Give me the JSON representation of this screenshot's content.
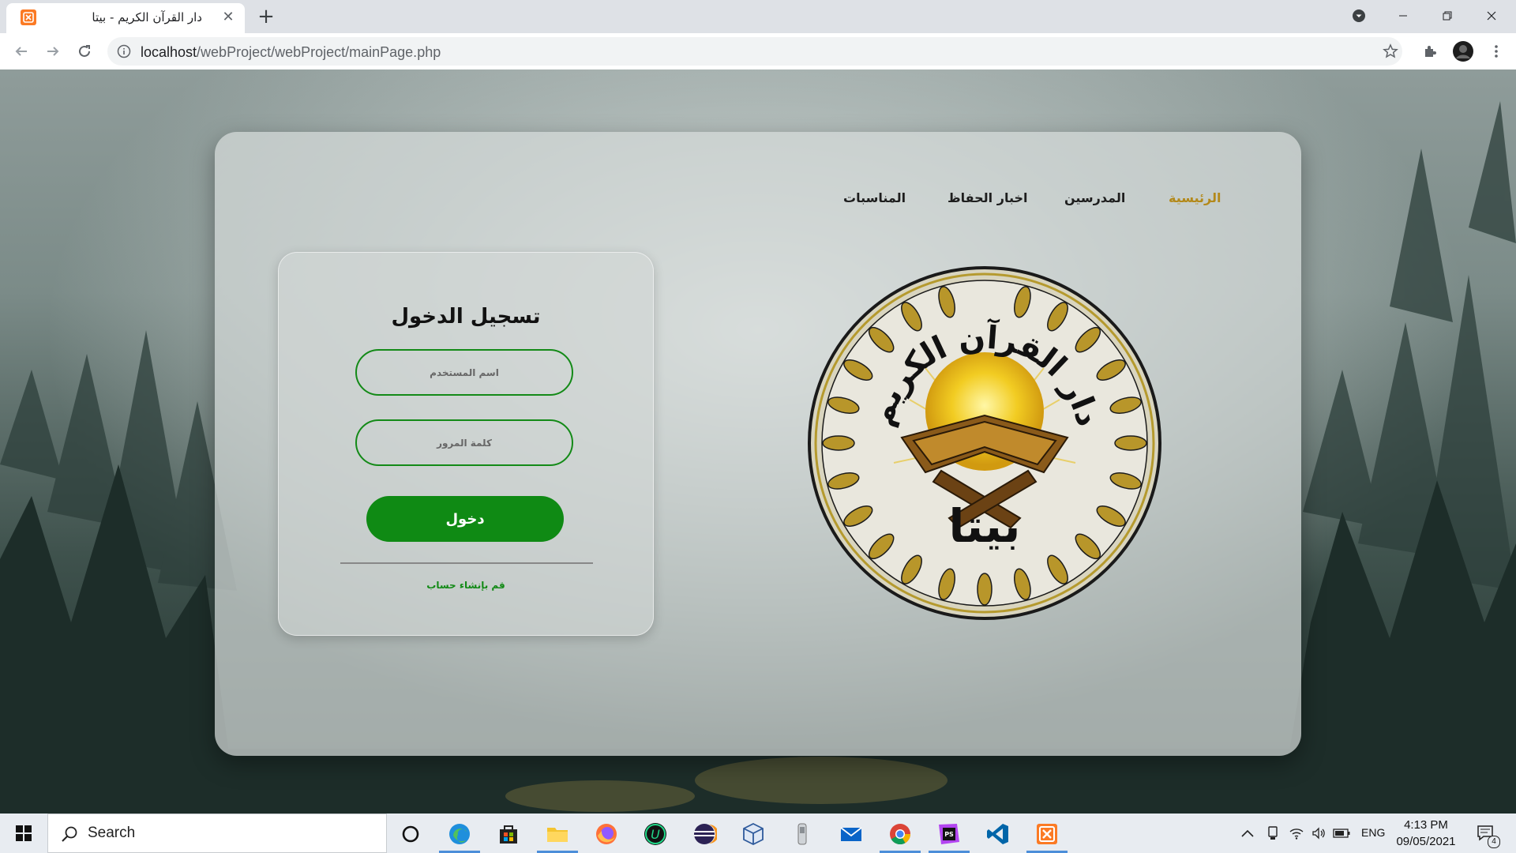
{
  "browser": {
    "tab_title": "دار القرآن الكريم - بيتا",
    "tab_close": "✕",
    "new_tab": "+",
    "url_host": "localhost",
    "url_path": "/webProject/webProject/mainPage.php"
  },
  "nav": {
    "items": [
      {
        "label": "الرئيسية",
        "active": true
      },
      {
        "label": "المدرسين",
        "active": false
      },
      {
        "label": "اخبار الحفاظ",
        "active": false
      },
      {
        "label": "المناسبات",
        "active": false
      }
    ]
  },
  "login": {
    "title": "تسجيل الدخول",
    "username_placeholder": "اسم المستخدم",
    "password_placeholder": "كلمة المرور",
    "submit_label": "دخول",
    "signup_link": "قم بإنشاء حساب"
  },
  "logo": {
    "arc_text": "دار القرآن الكريم",
    "name_text": "بيتا"
  },
  "taskbar": {
    "search_placeholder": "Search",
    "lang": "ENG",
    "time": "4:13 PM",
    "date": "09/05/2021",
    "notification_count": "4",
    "apps": [
      "cortana-icon",
      "edge-icon",
      "store-icon",
      "file-explorer-icon",
      "firefox-icon",
      "intellij-icon",
      "eclipse-icon",
      "virtualbox-icon",
      "device-icon",
      "mail-icon",
      "chrome-icon",
      "phpstorm-icon",
      "vscode-icon",
      "xampp-icon"
    ]
  },
  "colors": {
    "accent_green": "#0f8a14",
    "nav_active": "#b3891a",
    "xampp_orange": "#fb7a24"
  }
}
